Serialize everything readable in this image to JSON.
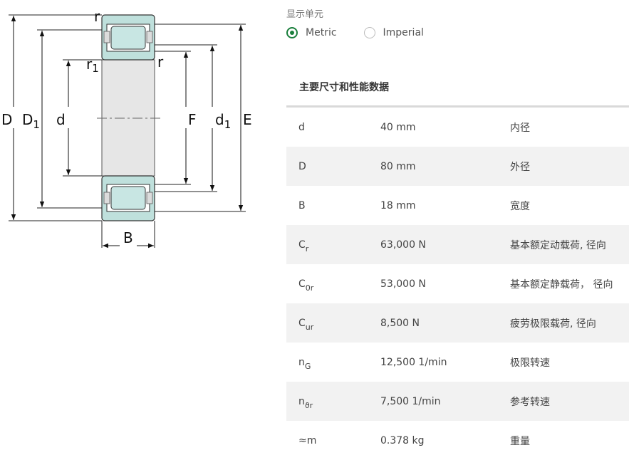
{
  "units": {
    "title": "显示单元",
    "options": [
      {
        "label": "Metric",
        "selected": true
      },
      {
        "label": "Imperial",
        "selected": false
      }
    ]
  },
  "drawing": {
    "labels": {
      "r_top": "r",
      "r1_main": "r",
      "r1_sub": "1",
      "r_right": "r",
      "D": "D",
      "D1_main": "D",
      "D1_sub": "1",
      "d": "d",
      "F": "F",
      "d1_main": "d",
      "d1_sub": "1",
      "E": "E",
      "B": "B"
    }
  },
  "section": {
    "title": "主要尺寸和性能数据"
  },
  "specs": [
    {
      "symbol": "d",
      "sub": "",
      "value": "40 mm",
      "desc": "内径"
    },
    {
      "symbol": "D",
      "sub": "",
      "value": "80 mm",
      "desc": "外径"
    },
    {
      "symbol": "B",
      "sub": "",
      "value": "18 mm",
      "desc": "宽度"
    },
    {
      "symbol": "C",
      "sub": "r",
      "value": "63,000 N",
      "desc": "基本额定动载荷, 径向"
    },
    {
      "symbol": "C",
      "sub": "0r",
      "value": "53,000 N",
      "desc": "基本额定静载荷， 径向"
    },
    {
      "symbol": "C",
      "sub": "ur",
      "value": "8,500 N",
      "desc": "疲劳极限载荷, 径向"
    },
    {
      "symbol": "n",
      "sub": "G",
      "value": "12,500 1/min",
      "desc": "极限转速"
    },
    {
      "symbol": "n",
      "sub": "ϑr",
      "value": "7,500 1/min",
      "desc": "参考转速"
    },
    {
      "symbol": "≈m",
      "sub": "",
      "value": "0.378 kg",
      "desc": "重量"
    }
  ],
  "colors": {
    "accent": "#1a7f3c",
    "ring_fill": "#bfe0dc",
    "roller_fill": "#c8e6e3",
    "bore_fill": "#e6e6e6",
    "row_stripe": "#f2f2f2"
  }
}
